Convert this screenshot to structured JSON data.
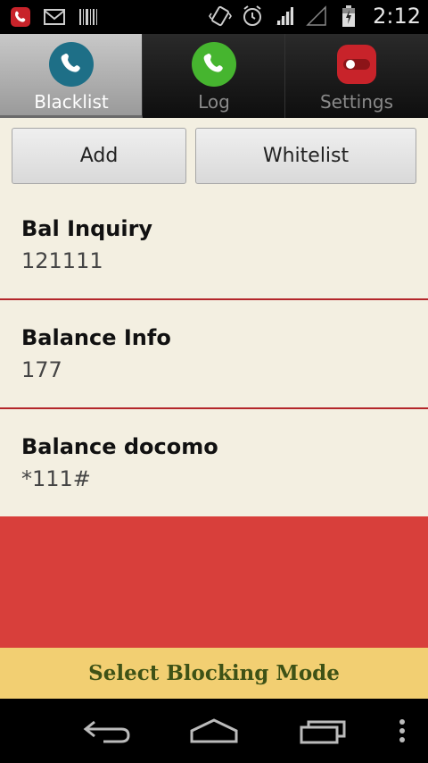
{
  "status_bar": {
    "time": "2:12",
    "left_icons": [
      "missed-call-icon",
      "gmail-icon",
      "barcode-icon"
    ],
    "right_icons": [
      "vibrate-icon",
      "alarm-icon",
      "signal-icon",
      "signal-empty-icon",
      "battery-icon"
    ]
  },
  "tabs": [
    {
      "label": "Blacklist",
      "icon": "phone-icon",
      "color": "#1e6f87",
      "active": true
    },
    {
      "label": "Log",
      "icon": "phone-icon",
      "color": "#46b52f",
      "active": false
    },
    {
      "label": "Settings",
      "icon": "toggle-icon",
      "color": "#c8232a",
      "active": false
    }
  ],
  "buttons": {
    "add_label": "Add",
    "whitelist_label": "Whitelist"
  },
  "blacklist": [
    {
      "name": "Bal Inquiry",
      "number": "121111"
    },
    {
      "name": "Balance Info",
      "number": "177"
    },
    {
      "name": "Balance docomo",
      "number": "*111#"
    }
  ],
  "mode_bar": {
    "label": "Select Blocking Mode"
  },
  "nav_bar": {
    "icons": [
      "back-icon",
      "home-icon",
      "recents-icon",
      "overflow-menu-icon"
    ]
  },
  "colors": {
    "content_bg": "#f3efe1",
    "divider": "#b3262a",
    "red_area": "#d83f3b",
    "mode_bar_bg": "#f2cf72",
    "mode_bar_text": "#3e5216"
  }
}
